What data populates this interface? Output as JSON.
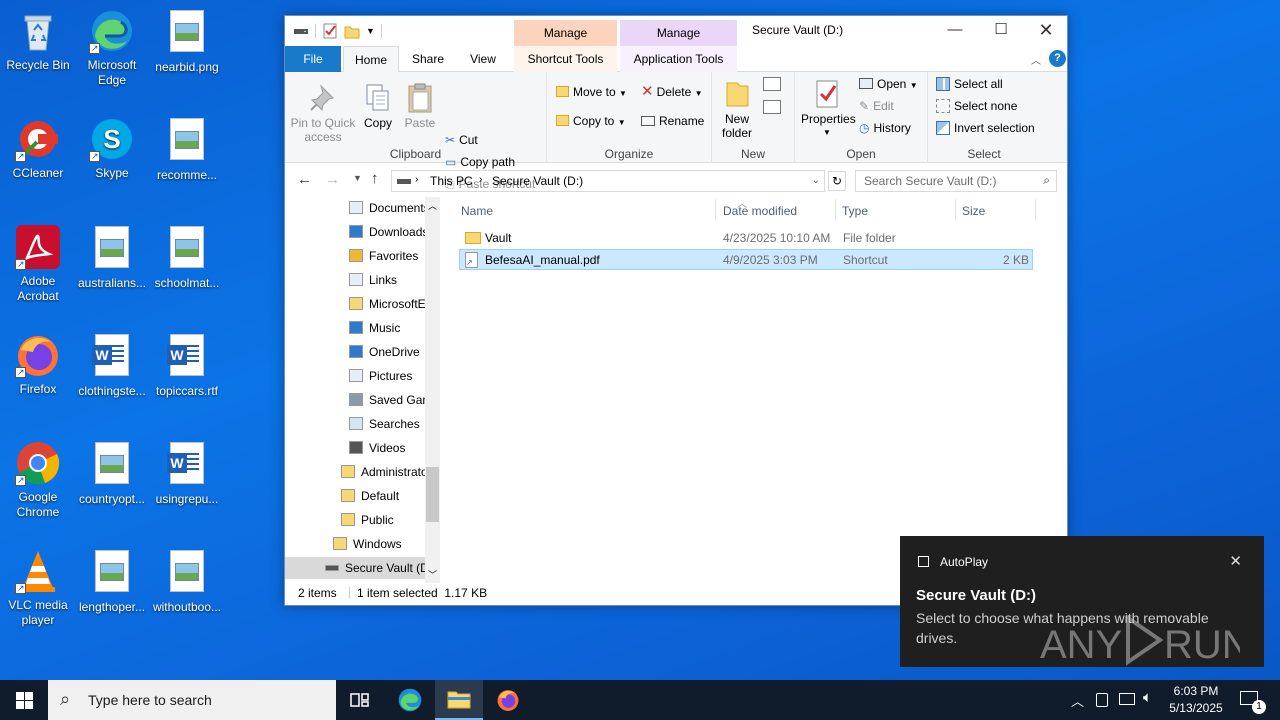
{
  "desktop": {
    "icons": [
      {
        "label": "Recycle Bin"
      },
      {
        "label": "Microsoft Edge"
      },
      {
        "label": "nearbid.png"
      },
      {
        "label": "CCleaner"
      },
      {
        "label": "Skype"
      },
      {
        "label": "recomme..."
      },
      {
        "label": "Adobe Acrobat"
      },
      {
        "label": "australians..."
      },
      {
        "label": "schoolmat..."
      },
      {
        "label": "Firefox"
      },
      {
        "label": "clothingste..."
      },
      {
        "label": "topiccars.rtf"
      },
      {
        "label": "Google Chrome"
      },
      {
        "label": "countryopt..."
      },
      {
        "label": "usingrepu..."
      },
      {
        "label": "VLC media player"
      },
      {
        "label": "lengthoper..."
      },
      {
        "label": "withoutboo..."
      }
    ]
  },
  "explorer": {
    "title": "Secure Vault (D:)",
    "context_tabs": [
      {
        "group": "Manage",
        "tab": "Shortcut Tools",
        "color": "#fcd3bd"
      },
      {
        "group": "Manage",
        "tab": "Application Tools",
        "color": "#ead6f7"
      }
    ],
    "tabs": {
      "file": "File",
      "home": "Home",
      "share": "Share",
      "view": "View"
    },
    "ribbon": {
      "clipboard": {
        "label": "Clipboard",
        "pin": "Pin to Quick access",
        "copy": "Copy",
        "paste": "Paste",
        "cut": "Cut",
        "copy_path": "Copy path",
        "paste_shortcut": "Paste shortcut"
      },
      "organize": {
        "label": "Organize",
        "move_to": "Move to",
        "copy_to": "Copy to",
        "delete": "Delete",
        "rename": "Rename"
      },
      "new": {
        "label": "New",
        "new_folder": "New folder"
      },
      "open": {
        "label": "Open",
        "properties": "Properties",
        "open": "Open",
        "edit": "Edit",
        "history": "History"
      },
      "select": {
        "label": "Select",
        "select_all": "Select all",
        "select_none": "Select none",
        "invert": "Invert selection"
      }
    },
    "address": {
      "crumbs": [
        "This PC",
        "Secure Vault (D:)"
      ],
      "search_placeholder": "Search Secure Vault (D:)"
    },
    "nav": [
      {
        "label": "Documents",
        "icon": "documents-icon"
      },
      {
        "label": "Downloads",
        "icon": "downloads-icon"
      },
      {
        "label": "Favorites",
        "icon": "favorites-icon"
      },
      {
        "label": "Links",
        "icon": "links-icon"
      },
      {
        "label": "MicrosoftEdge",
        "icon": "folder-icon"
      },
      {
        "label": "Music",
        "icon": "music-icon"
      },
      {
        "label": "OneDrive",
        "icon": "onedrive-icon"
      },
      {
        "label": "Pictures",
        "icon": "pictures-icon"
      },
      {
        "label": "Saved Games",
        "icon": "saved-games-icon"
      },
      {
        "label": "Searches",
        "icon": "searches-icon"
      },
      {
        "label": "Videos",
        "icon": "videos-icon"
      },
      {
        "label": "Administrator",
        "icon": "folder-icon"
      },
      {
        "label": "Default",
        "icon": "folder-icon"
      },
      {
        "label": "Public",
        "icon": "folder-icon"
      },
      {
        "label": "Windows",
        "icon": "folder-icon"
      },
      {
        "label": "Secure Vault (D:)",
        "icon": "drive-icon"
      }
    ],
    "columns": {
      "name": "Name",
      "date": "Date modified",
      "type": "Type",
      "size": "Size"
    },
    "files": [
      {
        "name": "Vault",
        "date": "4/23/2025 10:10 AM",
        "type": "File folder",
        "size": "",
        "selected": false
      },
      {
        "name": "BefesaAI_manual.pdf",
        "date": "4/9/2025 3:03 PM",
        "type": "Shortcut",
        "size": "2 KB",
        "selected": true
      }
    ],
    "status": {
      "count": "2 items",
      "selected": "1 item selected  1.17 KB"
    }
  },
  "toast": {
    "app": "AutoPlay",
    "title": "Secure Vault (D:)",
    "body": "Select to choose what happens with removable drives.",
    "watermark": "ANY RUN"
  },
  "taskbar": {
    "search_placeholder": "Type here to search",
    "time": "6:03 PM",
    "date": "5/13/2025",
    "notification_count": "1"
  }
}
